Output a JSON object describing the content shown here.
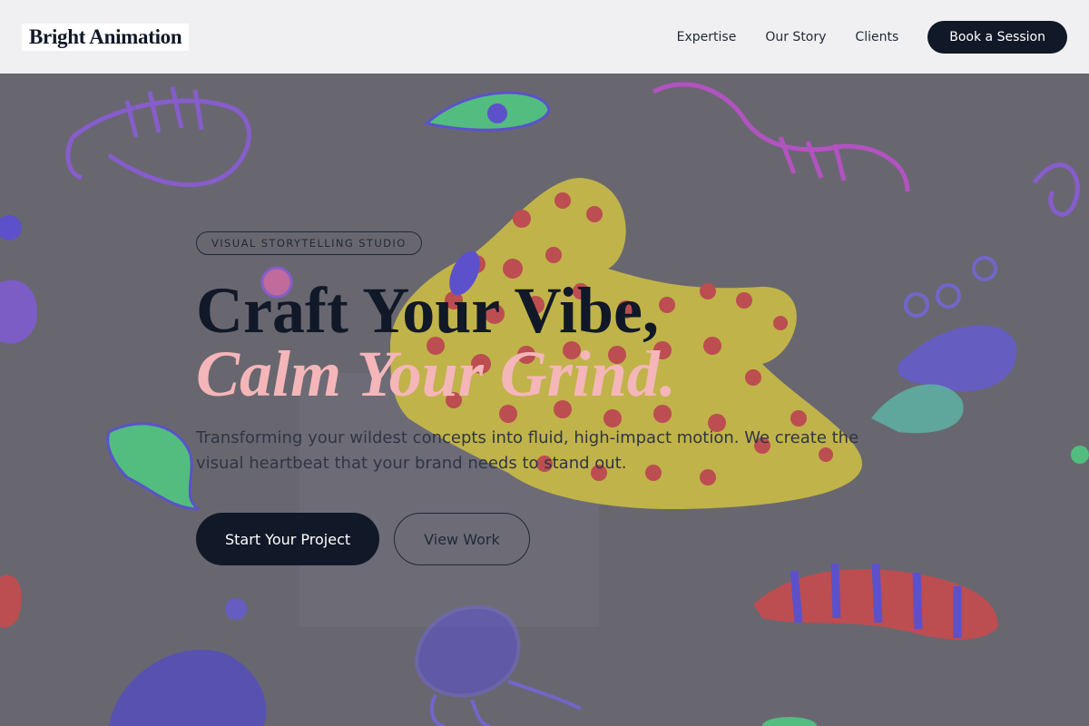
{
  "header": {
    "logo": "Bright Animation",
    "nav": [
      {
        "label": "Expertise"
      },
      {
        "label": "Our Story"
      },
      {
        "label": "Clients"
      }
    ],
    "cta": "Book a Session"
  },
  "hero": {
    "badge": "VISUAL STORYTELLING STUDIO",
    "headline_line1": "Craft Your Vibe,",
    "headline_line2": "Calm Your Grind.",
    "subtext": "Transforming your wildest concepts into fluid, high-impact motion. We create the visual heartbeat that your brand needs to stand out.",
    "primary_button": "Start Your Project",
    "secondary_button": "View Work"
  },
  "colors": {
    "brand_dark": "#111827",
    "accent_pink": "#f5b6b9",
    "header_bg": "#f0f0f2"
  }
}
